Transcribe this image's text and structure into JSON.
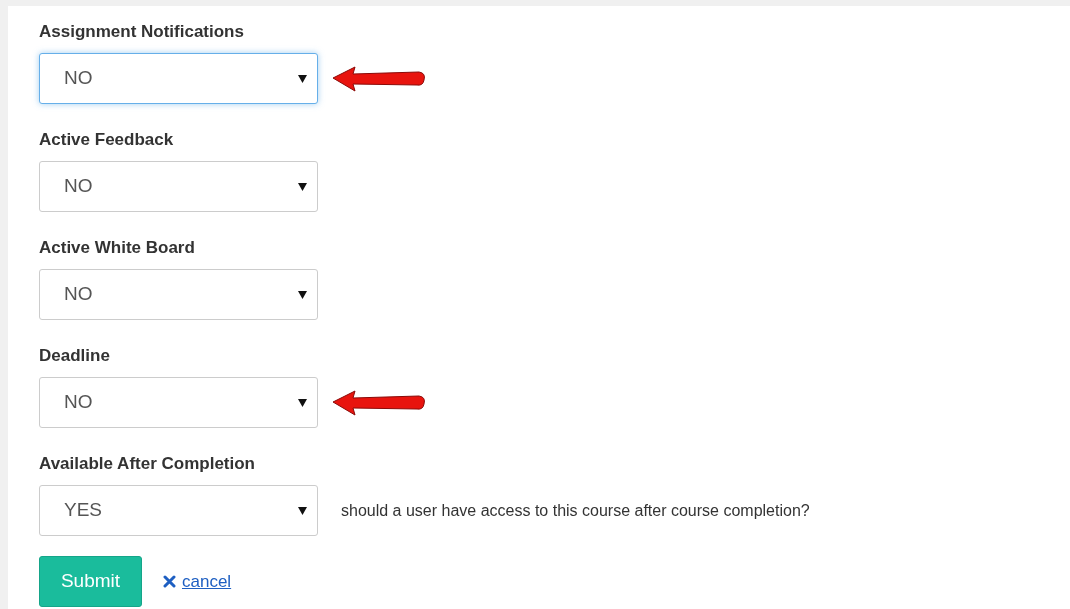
{
  "fields": [
    {
      "label": "Assignment Notifications",
      "value": "NO",
      "focused": true,
      "arrow": true
    },
    {
      "label": "Active Feedback",
      "value": "NO",
      "focused": false,
      "arrow": false
    },
    {
      "label": "Active White Board",
      "value": "NO",
      "focused": false,
      "arrow": false
    },
    {
      "label": "Deadline",
      "value": "NO",
      "focused": false,
      "arrow": true
    },
    {
      "label": "Available After Completion",
      "value": "YES",
      "focused": false,
      "arrow": false,
      "hint": "should a user have access to this course after course completion?"
    }
  ],
  "submit": "Submit",
  "cancel": "cancel"
}
